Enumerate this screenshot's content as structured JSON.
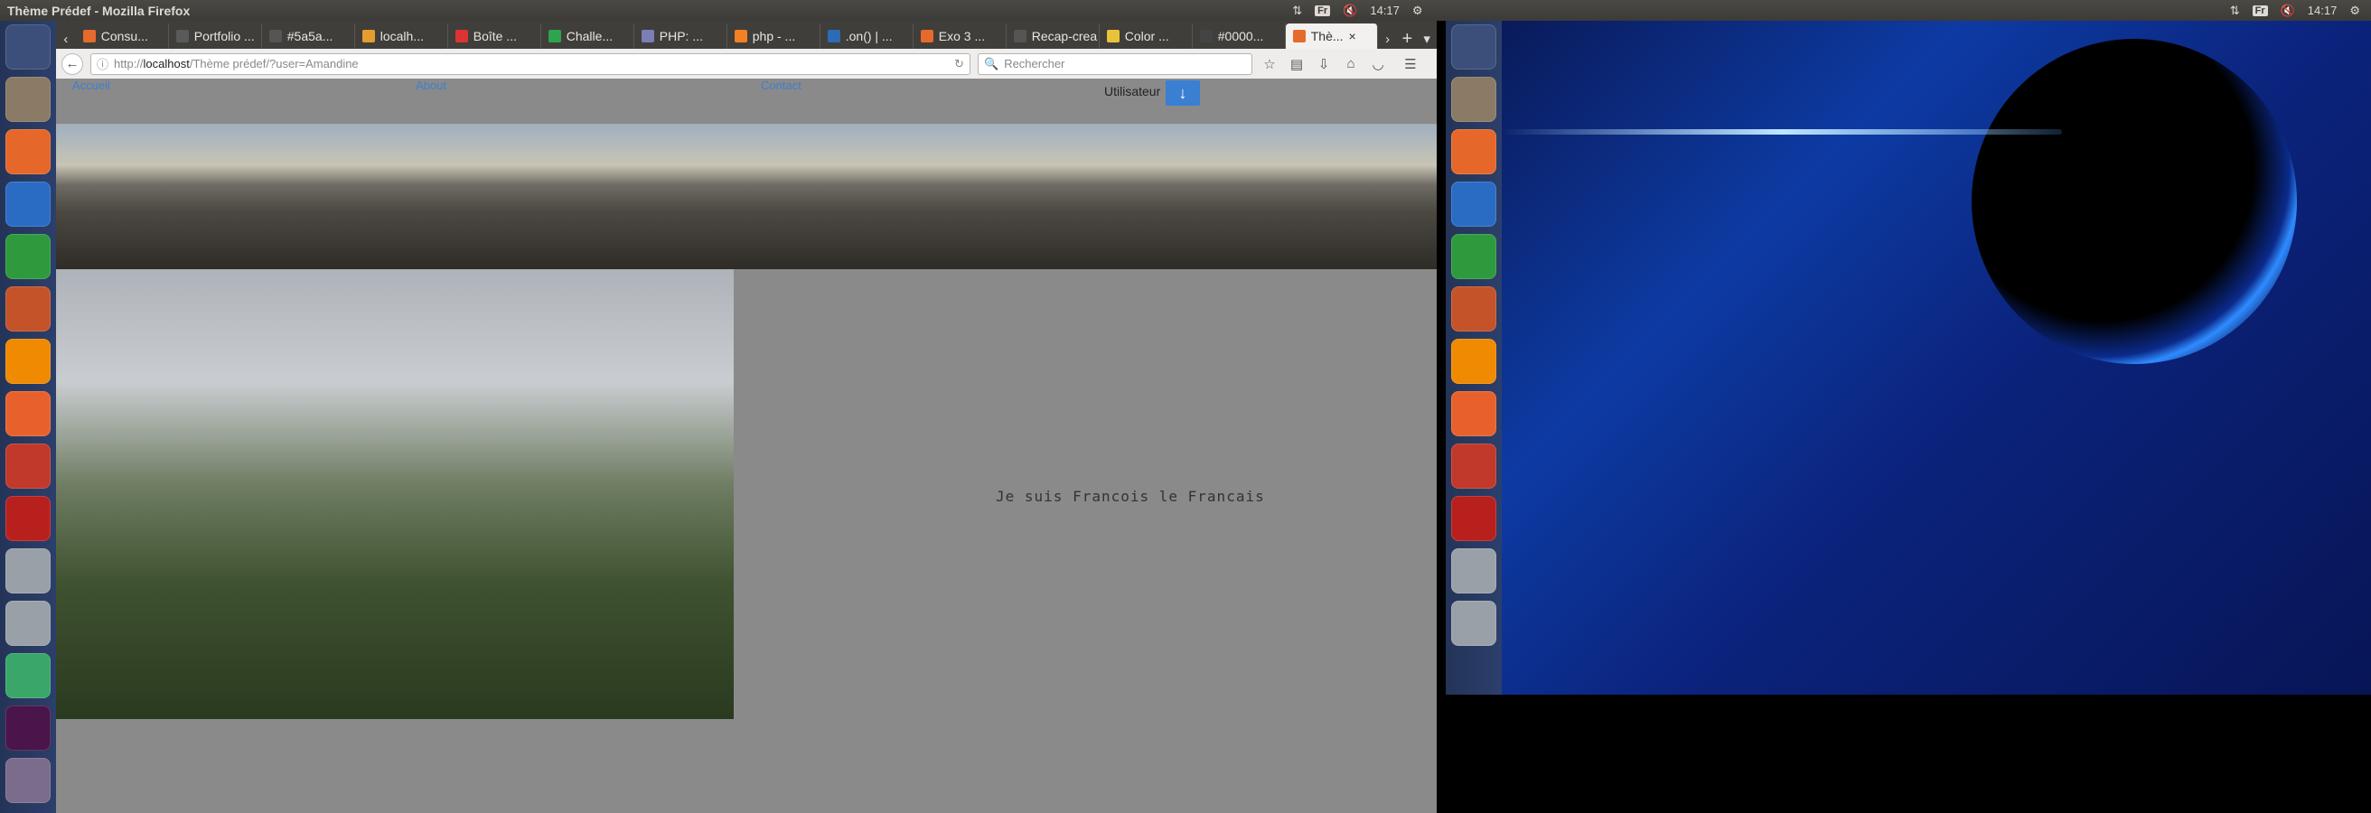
{
  "window_title": "Thème Prédef - Mozilla Firefox",
  "panel": {
    "keyboard": "Fr",
    "time_left": "14:17",
    "time_right": "14:17"
  },
  "tabs": [
    {
      "label": "Consu...",
      "color": "#e66a2c"
    },
    {
      "label": "Portfolio ...",
      "color": "#5a5a5a"
    },
    {
      "label": "#5a5a...",
      "color": "#555555"
    },
    {
      "label": "localh...",
      "color": "#e59d2d"
    },
    {
      "label": "Boîte ...",
      "color": "#d33"
    },
    {
      "label": "Challe...",
      "color": "#2ea44f"
    },
    {
      "label": "PHP: ...",
      "color": "#7b7fb5"
    },
    {
      "label": "php - ...",
      "color": "#f48024"
    },
    {
      "label": ".on() | ...",
      "color": "#2a6cb6"
    },
    {
      "label": "Exo 3 ...",
      "color": "#e66a2c"
    },
    {
      "label": "Recap-crea",
      "color": "#555555"
    },
    {
      "label": "Color ...",
      "color": "#e8c33a"
    },
    {
      "label": "#0000...",
      "color": "#444444"
    },
    {
      "label": "Thè...",
      "color": "#e66a2c"
    }
  ],
  "url": {
    "prefix": "http://",
    "host": "localhost",
    "path": "/Thème prédef/?user=Amandine"
  },
  "search_placeholder": "Rechercher",
  "site_nav": {
    "accueil": "Accueil",
    "about": "About",
    "contact": "Contact",
    "user_label": "Utilisateur"
  },
  "intro_text": "Je suis Francois le Francais",
  "launcher_icons": [
    "ubuntu-dash-icon",
    "files-icon",
    "firefox-icon",
    "writer-icon",
    "calc-icon",
    "impress-icon",
    "vlc-icon",
    "software-center-icon",
    "settings-icon",
    "filezilla-icon",
    "drive-icon",
    "drive-icon",
    "atom-icon",
    "slack-icon",
    "trash-icon"
  ]
}
